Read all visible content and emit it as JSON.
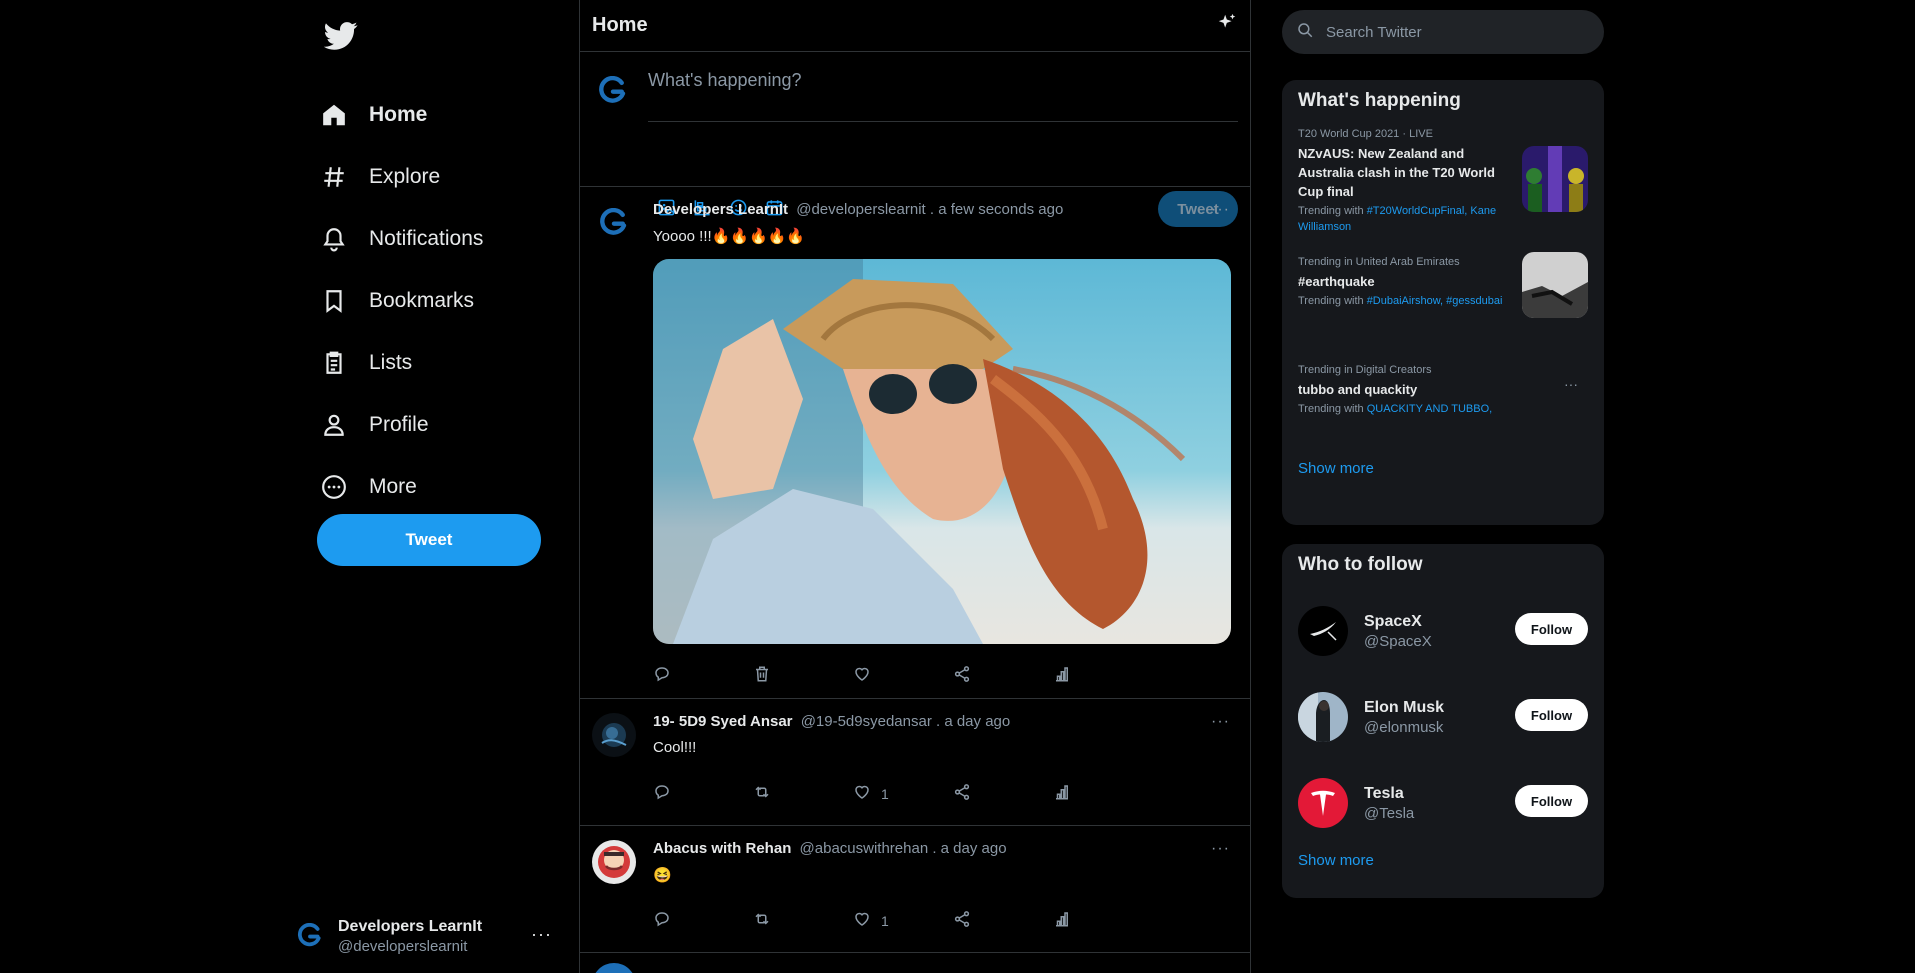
{
  "nav": {
    "items": [
      {
        "label": "Home",
        "icon": "home-icon",
        "active": true
      },
      {
        "label": "Explore",
        "icon": "hashtag-icon",
        "active": false
      },
      {
        "label": "Notifications",
        "icon": "bell-icon",
        "active": false
      },
      {
        "label": "Bookmarks",
        "icon": "bookmark-icon",
        "active": false
      },
      {
        "label": "Lists",
        "icon": "list-icon",
        "active": false
      },
      {
        "label": "Profile",
        "icon": "person-icon",
        "active": false
      },
      {
        "label": "More",
        "icon": "more-circle-icon",
        "active": false
      }
    ],
    "tweet_label": "Tweet"
  },
  "account": {
    "name": "Developers LearnIt",
    "handle": "@developerslearnit",
    "dots": "···"
  },
  "header": {
    "title": "Home"
  },
  "composer": {
    "placeholder": "What's happening?",
    "tweet_label": "Tweet"
  },
  "tweets": [
    {
      "name": "Developers LearnIt",
      "meta": "@developerslearnit . a few seconds ago",
      "text": "Yoooo !!!🔥🔥🔥🔥🔥",
      "more": "···",
      "like_count": ""
    },
    {
      "name": "19- 5D9 Syed Ansar",
      "meta": "@19-5d9syedansar . a day ago",
      "text": "Cool!!!",
      "more": "···",
      "like_count": "1"
    },
    {
      "name": "Abacus with Rehan",
      "meta": "@abacuswithrehan . a day ago",
      "text": "😆",
      "more": "···",
      "like_count": "1"
    }
  ],
  "search": {
    "placeholder": "Search Twitter"
  },
  "trends": {
    "title": "What's happening",
    "items": [
      {
        "category": "T20 World Cup 2021 · LIVE",
        "title": "NZvAUS: New Zealand and Australia clash in the T20 World Cup final",
        "with_prefix": "Trending with ",
        "tags": "#T20WorldCupFinal, Kane Williamson"
      },
      {
        "category": "Trending in United Arab Emirates",
        "title": "#earthquake",
        "with_prefix": "Trending with ",
        "tags": "#DubaiAirshow, #gessdubai"
      },
      {
        "category": "Trending in Digital Creators",
        "title": "tubbo and quackity",
        "with_prefix": "Trending with ",
        "tags": "QUACKITY AND TUBBO,",
        "dots": "···"
      }
    ],
    "show_more": "Show more"
  },
  "who_to_follow": {
    "title": "Who to follow",
    "items": [
      {
        "name": "SpaceX",
        "handle": "@SpaceX",
        "button": "Follow"
      },
      {
        "name": "Elon Musk",
        "handle": "@elonmusk",
        "button": "Follow"
      },
      {
        "name": "Tesla",
        "handle": "@Tesla",
        "button": "Follow"
      }
    ],
    "show_more": "Show more"
  },
  "colors": {
    "accent": "#1d9bf0",
    "background": "#000000",
    "panel": "#16181c",
    "muted": "#8b98a5"
  }
}
